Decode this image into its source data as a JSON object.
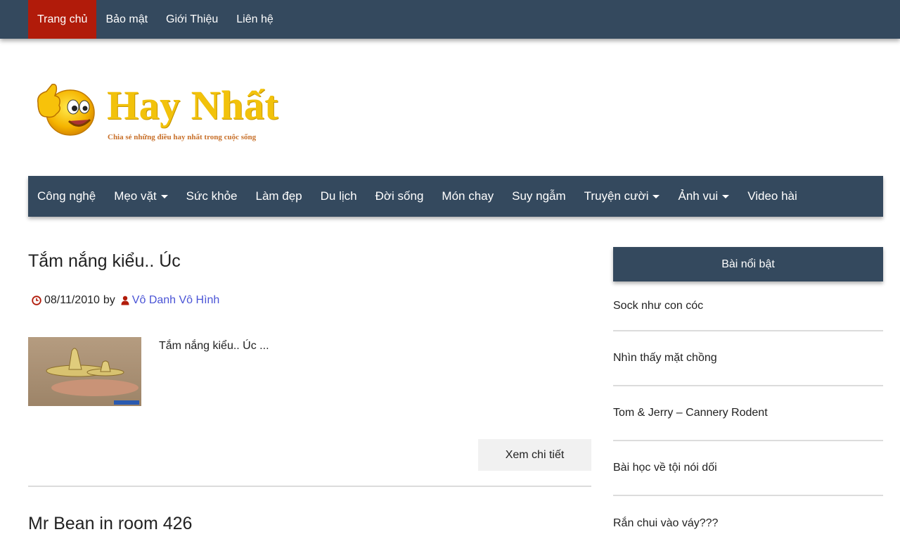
{
  "topnav": {
    "items": [
      "Trang chủ",
      "Bảo mật",
      "Giới Thiệu",
      "Liên hệ"
    ],
    "active": "Trang chủ"
  },
  "logo": {
    "title": "Hay Nhất",
    "tagline": "Chia sẻ những điều hay nhất trong cuộc sống",
    "icon": "thumbs-up-smiley-icon"
  },
  "catnav": {
    "items": [
      {
        "label": "Công nghệ",
        "dropdown": false
      },
      {
        "label": "Mẹo vặt",
        "dropdown": true
      },
      {
        "label": "Sức khỏe",
        "dropdown": false
      },
      {
        "label": "Làm đẹp",
        "dropdown": false
      },
      {
        "label": "Du lịch",
        "dropdown": false
      },
      {
        "label": "Đời sống",
        "dropdown": false
      },
      {
        "label": "Món chay",
        "dropdown": false
      },
      {
        "label": "Suy ngẫm",
        "dropdown": false
      },
      {
        "label": "Truyện cười",
        "dropdown": true
      },
      {
        "label": "Ảnh vui",
        "dropdown": true
      },
      {
        "label": "Video hài",
        "dropdown": false
      }
    ]
  },
  "post1": {
    "title": "Tắm nắng kiểu.. Úc",
    "date": "08/11/2010",
    "by": "by",
    "author": "Vô Danh Vô Hình",
    "excerpt": "Tắm nắng kiểu.. Úc ...",
    "read_more": "Xem chi tiết"
  },
  "post2": {
    "title": "Mr Bean in room 426"
  },
  "sidebar": {
    "title": "Bài nổi bật",
    "items": [
      "Sock như con cóc",
      "Nhìn thấy mặt chồng",
      "Tom & Jerry – Cannery Rodent",
      "Bài học về tội nói dối",
      "Rắn chui vào váy???"
    ]
  },
  "colors": {
    "nav_bg": "#34495e",
    "active_tab": "#b11b0a",
    "author_link": "#4a54d6",
    "logo_yellow": "#f2c20b"
  }
}
